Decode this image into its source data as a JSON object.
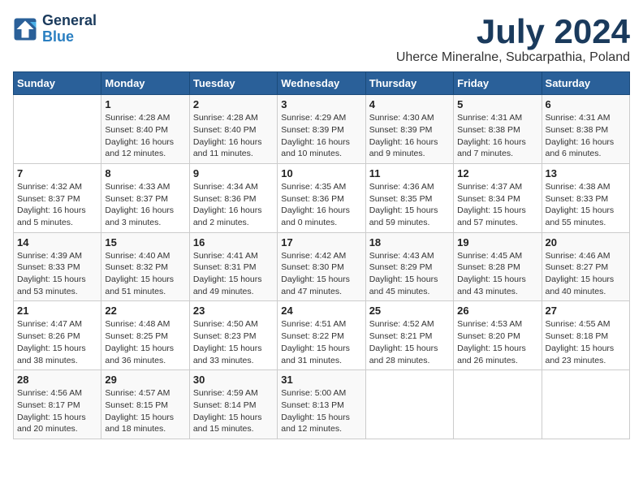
{
  "header": {
    "logo_line1": "General",
    "logo_line2": "Blue",
    "month_title": "July 2024",
    "location": "Uherce Mineralne, Subcarpathia, Poland"
  },
  "weekdays": [
    "Sunday",
    "Monday",
    "Tuesday",
    "Wednesday",
    "Thursday",
    "Friday",
    "Saturday"
  ],
  "weeks": [
    [
      {
        "day": "",
        "info": ""
      },
      {
        "day": "1",
        "info": "Sunrise: 4:28 AM\nSunset: 8:40 PM\nDaylight: 16 hours\nand 12 minutes."
      },
      {
        "day": "2",
        "info": "Sunrise: 4:28 AM\nSunset: 8:40 PM\nDaylight: 16 hours\nand 11 minutes."
      },
      {
        "day": "3",
        "info": "Sunrise: 4:29 AM\nSunset: 8:39 PM\nDaylight: 16 hours\nand 10 minutes."
      },
      {
        "day": "4",
        "info": "Sunrise: 4:30 AM\nSunset: 8:39 PM\nDaylight: 16 hours\nand 9 minutes."
      },
      {
        "day": "5",
        "info": "Sunrise: 4:31 AM\nSunset: 8:38 PM\nDaylight: 16 hours\nand 7 minutes."
      },
      {
        "day": "6",
        "info": "Sunrise: 4:31 AM\nSunset: 8:38 PM\nDaylight: 16 hours\nand 6 minutes."
      }
    ],
    [
      {
        "day": "7",
        "info": "Sunrise: 4:32 AM\nSunset: 8:37 PM\nDaylight: 16 hours\nand 5 minutes."
      },
      {
        "day": "8",
        "info": "Sunrise: 4:33 AM\nSunset: 8:37 PM\nDaylight: 16 hours\nand 3 minutes."
      },
      {
        "day": "9",
        "info": "Sunrise: 4:34 AM\nSunset: 8:36 PM\nDaylight: 16 hours\nand 2 minutes."
      },
      {
        "day": "10",
        "info": "Sunrise: 4:35 AM\nSunset: 8:36 PM\nDaylight: 16 hours\nand 0 minutes."
      },
      {
        "day": "11",
        "info": "Sunrise: 4:36 AM\nSunset: 8:35 PM\nDaylight: 15 hours\nand 59 minutes."
      },
      {
        "day": "12",
        "info": "Sunrise: 4:37 AM\nSunset: 8:34 PM\nDaylight: 15 hours\nand 57 minutes."
      },
      {
        "day": "13",
        "info": "Sunrise: 4:38 AM\nSunset: 8:33 PM\nDaylight: 15 hours\nand 55 minutes."
      }
    ],
    [
      {
        "day": "14",
        "info": "Sunrise: 4:39 AM\nSunset: 8:33 PM\nDaylight: 15 hours\nand 53 minutes."
      },
      {
        "day": "15",
        "info": "Sunrise: 4:40 AM\nSunset: 8:32 PM\nDaylight: 15 hours\nand 51 minutes."
      },
      {
        "day": "16",
        "info": "Sunrise: 4:41 AM\nSunset: 8:31 PM\nDaylight: 15 hours\nand 49 minutes."
      },
      {
        "day": "17",
        "info": "Sunrise: 4:42 AM\nSunset: 8:30 PM\nDaylight: 15 hours\nand 47 minutes."
      },
      {
        "day": "18",
        "info": "Sunrise: 4:43 AM\nSunset: 8:29 PM\nDaylight: 15 hours\nand 45 minutes."
      },
      {
        "day": "19",
        "info": "Sunrise: 4:45 AM\nSunset: 8:28 PM\nDaylight: 15 hours\nand 43 minutes."
      },
      {
        "day": "20",
        "info": "Sunrise: 4:46 AM\nSunset: 8:27 PM\nDaylight: 15 hours\nand 40 minutes."
      }
    ],
    [
      {
        "day": "21",
        "info": "Sunrise: 4:47 AM\nSunset: 8:26 PM\nDaylight: 15 hours\nand 38 minutes."
      },
      {
        "day": "22",
        "info": "Sunrise: 4:48 AM\nSunset: 8:25 PM\nDaylight: 15 hours\nand 36 minutes."
      },
      {
        "day": "23",
        "info": "Sunrise: 4:50 AM\nSunset: 8:23 PM\nDaylight: 15 hours\nand 33 minutes."
      },
      {
        "day": "24",
        "info": "Sunrise: 4:51 AM\nSunset: 8:22 PM\nDaylight: 15 hours\nand 31 minutes."
      },
      {
        "day": "25",
        "info": "Sunrise: 4:52 AM\nSunset: 8:21 PM\nDaylight: 15 hours\nand 28 minutes."
      },
      {
        "day": "26",
        "info": "Sunrise: 4:53 AM\nSunset: 8:20 PM\nDaylight: 15 hours\nand 26 minutes."
      },
      {
        "day": "27",
        "info": "Sunrise: 4:55 AM\nSunset: 8:18 PM\nDaylight: 15 hours\nand 23 minutes."
      }
    ],
    [
      {
        "day": "28",
        "info": "Sunrise: 4:56 AM\nSunset: 8:17 PM\nDaylight: 15 hours\nand 20 minutes."
      },
      {
        "day": "29",
        "info": "Sunrise: 4:57 AM\nSunset: 8:15 PM\nDaylight: 15 hours\nand 18 minutes."
      },
      {
        "day": "30",
        "info": "Sunrise: 4:59 AM\nSunset: 8:14 PM\nDaylight: 15 hours\nand 15 minutes."
      },
      {
        "day": "31",
        "info": "Sunrise: 5:00 AM\nSunset: 8:13 PM\nDaylight: 15 hours\nand 12 minutes."
      },
      {
        "day": "",
        "info": ""
      },
      {
        "day": "",
        "info": ""
      },
      {
        "day": "",
        "info": ""
      }
    ]
  ]
}
